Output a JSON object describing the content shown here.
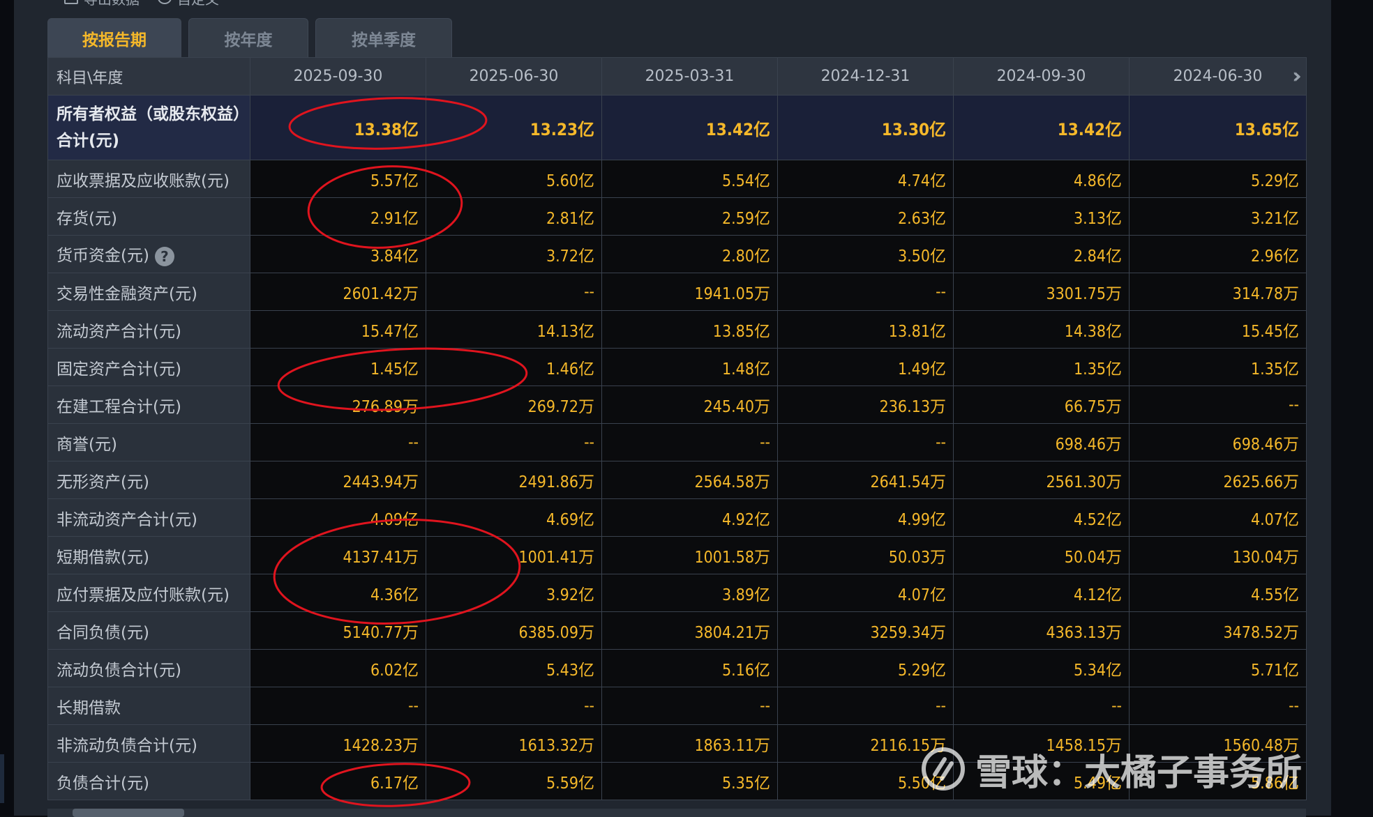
{
  "toolbar": {
    "export_label": "导出数据",
    "custom_label": "自定义"
  },
  "tabs": [
    {
      "label": "按报告期",
      "active": true
    },
    {
      "label": "按年度",
      "active": false
    },
    {
      "label": "按单季度",
      "active": false
    }
  ],
  "table": {
    "corner_label": "科目\\年度",
    "columns": [
      "2025-09-30",
      "2025-06-30",
      "2025-03-31",
      "2024-12-31",
      "2024-09-30",
      "2024-06-30"
    ],
    "rows": [
      {
        "label": "所有者权益（或股东权益）合计(元)",
        "values": [
          "13.38亿",
          "13.23亿",
          "13.42亿",
          "13.30亿",
          "13.42亿",
          "13.65亿"
        ]
      },
      {
        "label": "应收票据及应收账款(元)",
        "values": [
          "5.57亿",
          "5.60亿",
          "5.54亿",
          "4.74亿",
          "4.86亿",
          "5.29亿"
        ]
      },
      {
        "label": "存货(元)",
        "values": [
          "2.91亿",
          "2.81亿",
          "2.59亿",
          "2.63亿",
          "3.13亿",
          "3.21亿"
        ]
      },
      {
        "label": "货币资金(元)",
        "values": [
          "3.84亿",
          "3.72亿",
          "2.80亿",
          "3.50亿",
          "2.84亿",
          "2.96亿"
        ]
      },
      {
        "label": "交易性金融资产(元)",
        "values": [
          "2601.42万",
          "--",
          "1941.05万",
          "--",
          "3301.75万",
          "314.78万"
        ]
      },
      {
        "label": "流动资产合计(元)",
        "values": [
          "15.47亿",
          "14.13亿",
          "13.85亿",
          "13.81亿",
          "14.38亿",
          "15.45亿"
        ]
      },
      {
        "label": "固定资产合计(元)",
        "values": [
          "1.45亿",
          "1.46亿",
          "1.48亿",
          "1.49亿",
          "1.35亿",
          "1.35亿"
        ]
      },
      {
        "label": "在建工程合计(元)",
        "values": [
          "276.89万",
          "269.72万",
          "245.40万",
          "236.13万",
          "66.75万",
          "--"
        ]
      },
      {
        "label": "商誉(元)",
        "values": [
          "--",
          "--",
          "--",
          "--",
          "698.46万",
          "698.46万"
        ]
      },
      {
        "label": "无形资产(元)",
        "values": [
          "2443.94万",
          "2491.86万",
          "2564.58万",
          "2641.54万",
          "2561.30万",
          "2625.66万"
        ]
      },
      {
        "label": "非流动资产合计(元)",
        "values": [
          "4.09亿",
          "4.69亿",
          "4.92亿",
          "4.99亿",
          "4.52亿",
          "4.07亿"
        ]
      },
      {
        "label": "短期借款(元)",
        "values": [
          "4137.41万",
          "1001.41万",
          "1001.58万",
          "50.03万",
          "50.04万",
          "130.04万"
        ]
      },
      {
        "label": "应付票据及应付账款(元)",
        "values": [
          "4.36亿",
          "3.92亿",
          "3.89亿",
          "4.07亿",
          "4.12亿",
          "4.55亿"
        ]
      },
      {
        "label": "合同负债(元)",
        "values": [
          "5140.77万",
          "6385.09万",
          "3804.21万",
          "3259.34万",
          "4363.13万",
          "3478.52万"
        ]
      },
      {
        "label": "流动负债合计(元)",
        "values": [
          "6.02亿",
          "5.43亿",
          "5.16亿",
          "5.29亿",
          "5.34亿",
          "5.71亿"
        ]
      },
      {
        "label": "长期借款",
        "values": [
          "--",
          "--",
          "--",
          "--",
          "--",
          "--"
        ]
      },
      {
        "label": "非流动负债合计(元)",
        "values": [
          "1428.23万",
          "1613.32万",
          "1863.11万",
          "2116.15万",
          "1458.15万",
          "1560.48万"
        ]
      },
      {
        "label": "负债合计(元)",
        "values": [
          "6.17亿",
          "5.59亿",
          "5.35亿",
          "5.50亿",
          "5.49亿",
          "5.86亿"
        ]
      }
    ]
  },
  "watermark": {
    "text": "雪球：大橘子事务所"
  },
  "colors": {
    "value": "#f5b82a",
    "annotation": "#e0141e",
    "highlight_row": "#1a2038"
  }
}
